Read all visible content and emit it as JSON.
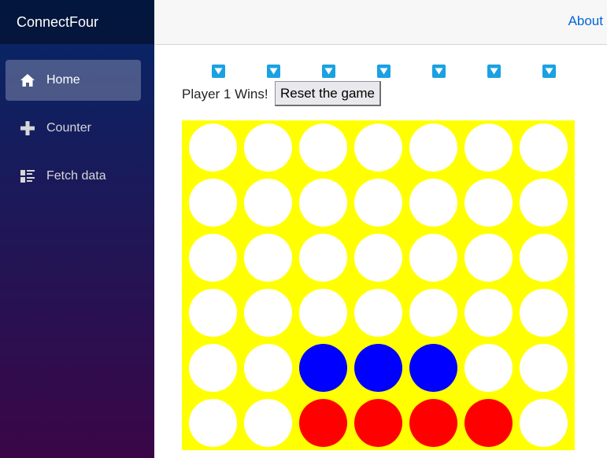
{
  "app": {
    "title": "ConnectFour"
  },
  "topbar": {
    "about_label": "About"
  },
  "sidebar": {
    "items": [
      {
        "label": "Home",
        "icon": "home-icon",
        "active": true
      },
      {
        "label": "Counter",
        "icon": "plus-icon",
        "active": false
      },
      {
        "label": "Fetch data",
        "icon": "list-rich-icon",
        "active": false
      }
    ]
  },
  "game": {
    "status": "Player 1 Wins!",
    "reset_label": "Reset the game",
    "columns": 7,
    "rows": 6,
    "colors": {
      "board": "#ffff00",
      "empty": "#ffffff",
      "player1": "#ff0000",
      "player2": "#0000ff",
      "drop_button": "#1ba1e2"
    },
    "grid": [
      [
        "empty",
        "empty",
        "empty",
        "empty",
        "empty",
        "empty",
        "empty"
      ],
      [
        "empty",
        "empty",
        "empty",
        "empty",
        "empty",
        "empty",
        "empty"
      ],
      [
        "empty",
        "empty",
        "empty",
        "empty",
        "empty",
        "empty",
        "empty"
      ],
      [
        "empty",
        "empty",
        "empty",
        "empty",
        "empty",
        "empty",
        "empty"
      ],
      [
        "empty",
        "empty",
        "player2",
        "player2",
        "player2",
        "empty",
        "empty"
      ],
      [
        "empty",
        "empty",
        "player1",
        "player1",
        "player1",
        "player1",
        "empty"
      ]
    ]
  }
}
